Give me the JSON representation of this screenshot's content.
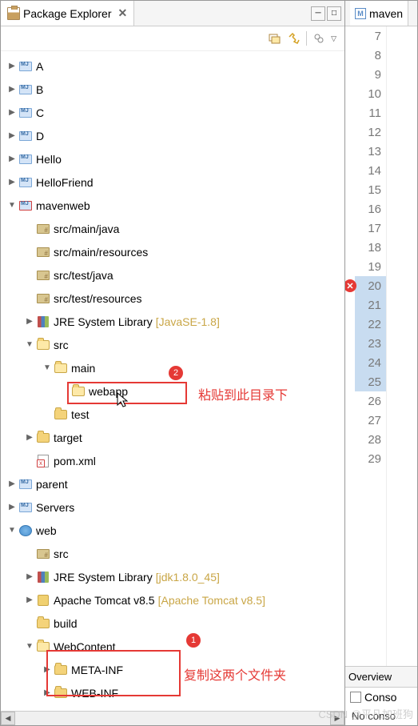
{
  "tab": {
    "title": "Package Explorer",
    "close": "✕"
  },
  "toolbar": {
    "min": "─",
    "max": "□"
  },
  "tree": [
    {
      "depth": 0,
      "arrow": "right",
      "icon": "java-project",
      "label": "A"
    },
    {
      "depth": 0,
      "arrow": "right",
      "icon": "java-project",
      "label": "B"
    },
    {
      "depth": 0,
      "arrow": "right",
      "icon": "java-project",
      "label": "C"
    },
    {
      "depth": 0,
      "arrow": "right",
      "icon": "java-project",
      "label": "D"
    },
    {
      "depth": 0,
      "arrow": "right",
      "icon": "java-project",
      "label": "Hello"
    },
    {
      "depth": 0,
      "arrow": "right",
      "icon": "java-project",
      "label": "HelloFriend"
    },
    {
      "depth": 0,
      "arrow": "down",
      "icon": "java-project-err",
      "label": "mavenweb"
    },
    {
      "depth": 1,
      "arrow": "none",
      "icon": "src-folder",
      "label": "src/main/java"
    },
    {
      "depth": 1,
      "arrow": "none",
      "icon": "src-folder",
      "label": "src/main/resources"
    },
    {
      "depth": 1,
      "arrow": "none",
      "icon": "src-folder",
      "label": "src/test/java"
    },
    {
      "depth": 1,
      "arrow": "none",
      "icon": "src-folder",
      "label": "src/test/resources"
    },
    {
      "depth": 1,
      "arrow": "right",
      "icon": "library",
      "label": "JRE System Library",
      "suffix": "[JavaSE-1.8]"
    },
    {
      "depth": 1,
      "arrow": "down",
      "icon": "folder-open",
      "label": "src"
    },
    {
      "depth": 2,
      "arrow": "down",
      "icon": "folder-open",
      "label": "main"
    },
    {
      "depth": 3,
      "arrow": "none",
      "icon": "folder-open",
      "label": "webapp"
    },
    {
      "depth": 2,
      "arrow": "none",
      "icon": "folder",
      "label": "test"
    },
    {
      "depth": 1,
      "arrow": "right",
      "icon": "folder",
      "label": "target"
    },
    {
      "depth": 1,
      "arrow": "none",
      "icon": "xml",
      "label": "pom.xml"
    },
    {
      "depth": 0,
      "arrow": "right",
      "icon": "java-project",
      "label": "parent"
    },
    {
      "depth": 0,
      "arrow": "right",
      "icon": "java-project",
      "label": "Servers"
    },
    {
      "depth": 0,
      "arrow": "down",
      "icon": "web-project",
      "label": "web"
    },
    {
      "depth": 1,
      "arrow": "none",
      "icon": "src-folder",
      "label": "src"
    },
    {
      "depth": 1,
      "arrow": "right",
      "icon": "library",
      "label": "JRE System Library",
      "suffix": "[jdk1.8.0_45]"
    },
    {
      "depth": 1,
      "arrow": "right",
      "icon": "tomcat",
      "label": "Apache Tomcat v8.5",
      "suffix": "[Apache Tomcat v8.5]"
    },
    {
      "depth": 1,
      "arrow": "none",
      "icon": "folder",
      "label": "build"
    },
    {
      "depth": 1,
      "arrow": "down",
      "icon": "folder-open",
      "label": "WebContent"
    },
    {
      "depth": 2,
      "arrow": "right",
      "icon": "folder",
      "label": "META-INF"
    },
    {
      "depth": 2,
      "arrow": "right",
      "icon": "folder",
      "label": "WEB-INF"
    }
  ],
  "editor": {
    "tab_label": "maven",
    "lines": [
      {
        "n": 7
      },
      {
        "n": 8
      },
      {
        "n": 9
      },
      {
        "n": 10
      },
      {
        "n": 11
      },
      {
        "n": 12
      },
      {
        "n": 13
      },
      {
        "n": 14
      },
      {
        "n": 15
      },
      {
        "n": 16
      },
      {
        "n": 17
      },
      {
        "n": 18
      },
      {
        "n": 19
      },
      {
        "n": 20,
        "error": true,
        "hl": true
      },
      {
        "n": 21,
        "hl": true
      },
      {
        "n": 22,
        "hl": true
      },
      {
        "n": 23,
        "hl": true
      },
      {
        "n": 24,
        "hl": true
      },
      {
        "n": 25,
        "hl": true
      },
      {
        "n": 26
      },
      {
        "n": 27
      },
      {
        "n": 28
      },
      {
        "n": 29
      }
    ],
    "bottom_tab": "Overview"
  },
  "console": {
    "tab": "Conso",
    "text": "No conso"
  },
  "annotations": {
    "badge1": "1",
    "badge2": "2",
    "text1": "粘贴到此目录下",
    "text2": "复制这两个文件夹"
  },
  "watermark": "CSDN @平凡加班狗"
}
